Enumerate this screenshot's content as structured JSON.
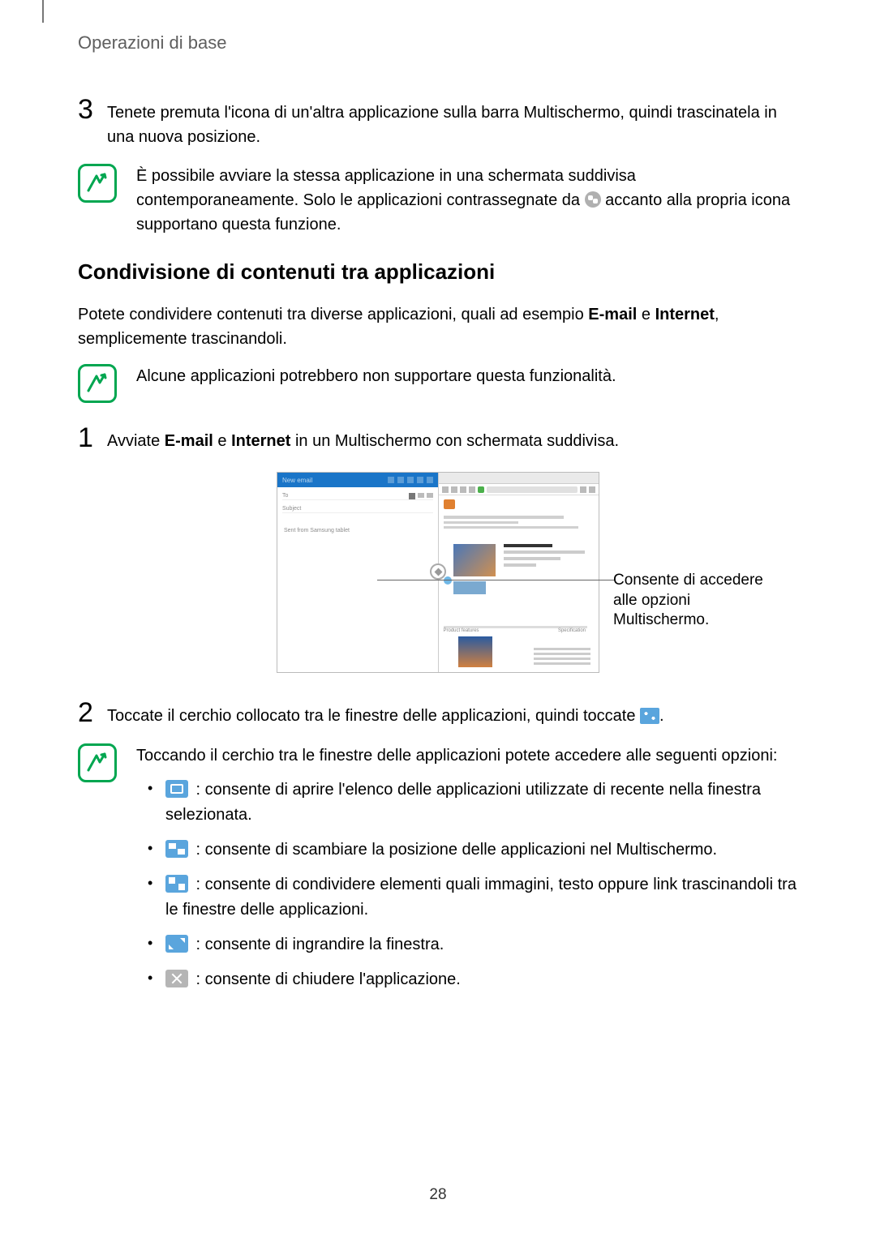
{
  "header": "Operazioni di base",
  "step3": {
    "num": "3",
    "text": "Tenete premuta l'icona di un'altra applicazione sulla barra Multischermo, quindi trascinatela in una nuova posizione."
  },
  "tip1": {
    "prefix": "È possibile avviare la stessa applicazione in una schermata suddivisa contemporaneamente. Solo le applicazioni contrassegnate da ",
    "suffix": " accanto alla propria icona supportano questa funzione."
  },
  "section_heading": "Condivisione di contenuti tra applicazioni",
  "intro": {
    "prefix": "Potete condividere contenuti tra diverse applicazioni, quali ad esempio ",
    "email": "E-mail",
    "and1": " e ",
    "internet": "Internet",
    "suffix": ", semplicemente trascinandoli."
  },
  "tip2": "Alcune applicazioni potrebbero non supportare questa funzionalità.",
  "step1": {
    "num": "1",
    "prefix": "Avviate ",
    "email": "E-mail",
    "and": " e ",
    "internet": "Internet",
    "suffix": " in un Multischermo con schermata suddivisa."
  },
  "figure_callout": "Consente di accedere alle opzioni Multischermo.",
  "step2": {
    "num": "2",
    "prefix": "Toccate il cerchio collocato tra le finestre delle applicazioni, quindi toccate ",
    "suffix": "."
  },
  "tip3": {
    "intro": "Toccando il cerchio tra le finestre delle applicazioni potete accedere alle seguenti opzioni:",
    "options": [
      " : consente di aprire l'elenco delle applicazioni utilizzate di recente nella finestra selezionata.",
      " : consente di scambiare la posizione delle applicazioni nel Multischermo.",
      " : consente di condividere elementi quali immagini, testo oppure link trascinandoli tra le finestre delle applicazioni.",
      " : consente di ingrandire la finestra.",
      " : consente di chiudere l'applicazione."
    ]
  },
  "page_number": "28"
}
